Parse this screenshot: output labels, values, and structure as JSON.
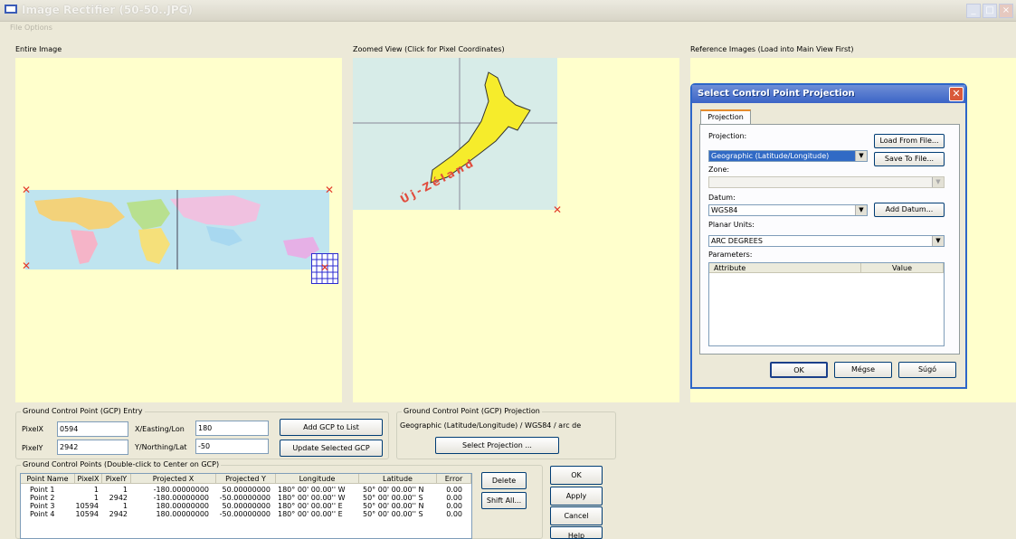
{
  "window": {
    "title": "Image Rectifier (50-50..JPG)"
  },
  "menu": {
    "file": "File",
    "options": "Options"
  },
  "panels": {
    "entire": "Entire Image",
    "zoomed": "Zoomed View (Click for Pixel Coordinates)",
    "reference": "Reference Images (Load into Main View First)"
  },
  "zoom_map": {
    "label": "Új-Zéland"
  },
  "gcp_entry": {
    "group_title": "Ground Control Point (GCP) Entry",
    "pixel_x_label": "PixelX",
    "pixel_x_value": "0594",
    "pixel_y_label": "PixelY",
    "pixel_y_value": "2942",
    "x_label": "X/Easting/Lon",
    "x_value": "180",
    "y_label": "Y/Northing/Lat",
    "y_value": "-50",
    "add_btn": "Add GCP to List",
    "update_btn": "Update Selected GCP"
  },
  "gcp_projection": {
    "group_title": "Ground Control Point (GCP) Projection",
    "text": "Geographic (Latitude/Longitude) / WGS84 / arc de",
    "select_btn": "Select Projection ..."
  },
  "gcp_points": {
    "group_title": "Ground Control Points (Double-click to Center on GCP)",
    "columns": [
      "Point Name",
      "PixelX",
      "PixelY",
      "Projected X",
      "Projected Y",
      "Longitude",
      "Latitude",
      "Error"
    ],
    "rows": [
      [
        "Point 1",
        "1",
        "1",
        "-180.00000000",
        "50.00000000",
        "180° 00' 00.00'' W",
        "50° 00' 00.00'' N",
        "0.00"
      ],
      [
        "Point 2",
        "1",
        "2942",
        "-180.00000000",
        "-50.00000000",
        "180° 00' 00.00'' W",
        "50° 00' 00.00'' S",
        "0.00"
      ],
      [
        "Point 3",
        "10594",
        "1",
        "180.00000000",
        "50.00000000",
        "180° 00' 00.00'' E",
        "50° 00' 00.00'' N",
        "0.00"
      ],
      [
        "Point 4",
        "10594",
        "2942",
        "180.00000000",
        "-50.00000000",
        "180° 00' 00.00'' E",
        "50° 00' 00.00'' S",
        "0.00"
      ]
    ],
    "delete_btn": "Delete",
    "shift_btn": "Shift All..."
  },
  "main_buttons": {
    "ok": "OK",
    "apply": "Apply",
    "cancel": "Cancel",
    "help": "Help"
  },
  "dialog": {
    "title": "Select Control Point Projection",
    "tab": "Projection",
    "projection_label": "Projection:",
    "projection_value": "Geographic (Latitude/Longitude)",
    "load_btn": "Load From File...",
    "save_btn": "Save To File...",
    "zone_label": "Zone:",
    "zone_value": "",
    "datum_label": "Datum:",
    "datum_value": "WGS84",
    "add_datum_btn": "Add Datum...",
    "units_label": "Planar Units:",
    "units_value": "ARC DEGREES",
    "params_label": "Parameters:",
    "param_cols": [
      "Attribute",
      "Value"
    ],
    "ok": "OK",
    "cancel": "Mégse",
    "help": "Súgó"
  }
}
